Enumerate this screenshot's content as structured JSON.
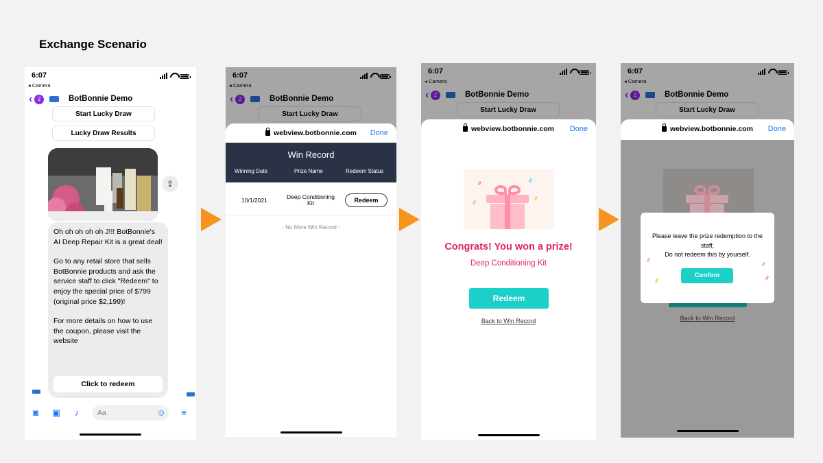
{
  "title": "Exchange Scenario",
  "status": {
    "time": "6:07",
    "back_app": "◂ Camera"
  },
  "chat_header": {
    "badge": "2",
    "name": "BotBonnie Demo"
  },
  "panel1": {
    "quick_replies": [
      "Start Lucky Draw",
      "Lucky Draw Results"
    ],
    "message_paragraphs": [
      "Oh oh oh oh oh J!!! BotBonnie's AI Deep Repair Kit is a great deal!",
      "Go to any retail store that sells BotBonnie products and ask the service staff to click \"Redeem\" to enjoy the special price of $799 (original price $2,199)!",
      "For more details on how to use the coupon, please visit the website"
    ],
    "button": "Click to redeem",
    "composer_placeholder": "Aa"
  },
  "webview": {
    "url": "webview.botbonnie.com",
    "done": "Done",
    "behind_button": "Start Lucky Draw"
  },
  "panel2": {
    "header": "Win Record",
    "columns": [
      "Winning Date",
      "Prize Name",
      "Redeem Status"
    ],
    "rows": [
      {
        "date": "10/1/2021",
        "prize": "Deep Conditioning Kit",
        "action": "Redeem"
      }
    ],
    "footer": "- No More Win Record -"
  },
  "panel3": {
    "congrats": "Congrats! You won a prize!",
    "prize": "Deep Conditioning Kit",
    "redeem": "Redeem",
    "back_link": "Back to Win Record"
  },
  "panel4": {
    "modal_line1": "Please leave the prize redemption to the staff,",
    "modal_line2": "Do not redeem this by yourself.",
    "confirm": "Confirm",
    "back_link": "Back to Win Record"
  },
  "colors": {
    "accent_orange": "#f7941d",
    "teal": "#1ccfc9",
    "pink": "#e0245e",
    "navy": "#2b3245",
    "messenger_blue": "#1877f2"
  }
}
